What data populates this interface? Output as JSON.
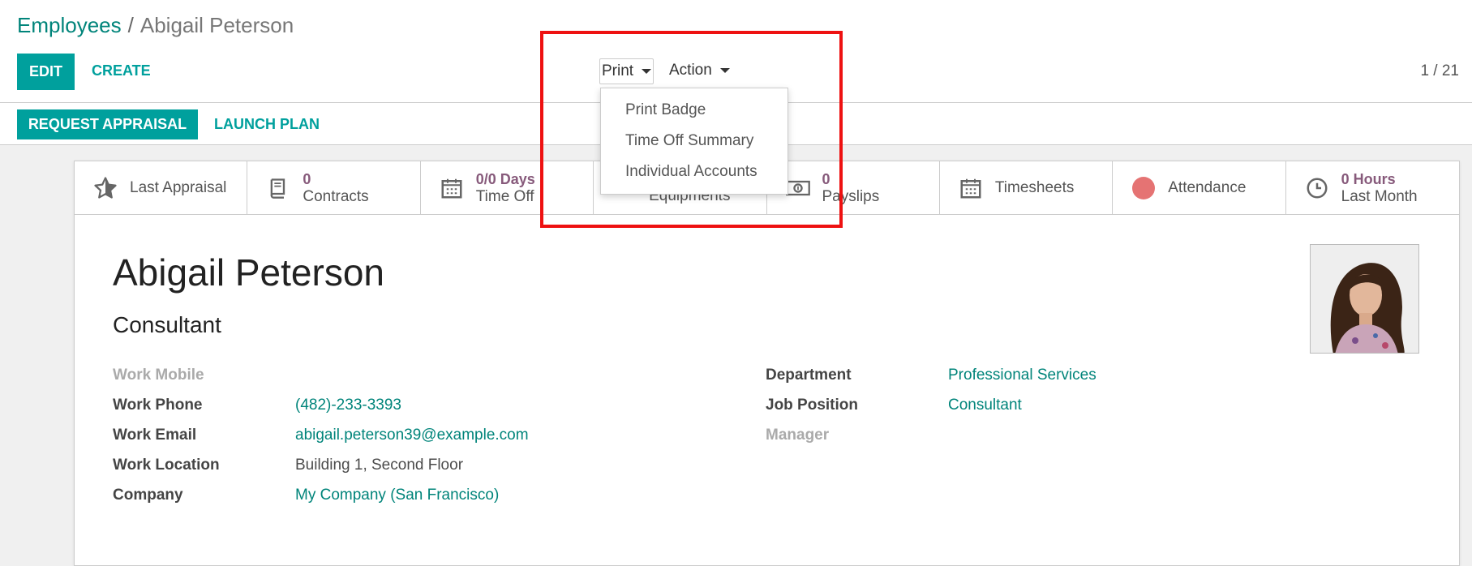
{
  "breadcrumb": {
    "parent": "Employees",
    "separator": "/",
    "current": "Abigail Peterson"
  },
  "toolbar": {
    "edit_label": "EDIT",
    "create_label": "CREATE",
    "print_label": "Print",
    "action_label": "Action",
    "pager": "1 / 21"
  },
  "print_menu": {
    "items": [
      "Print Badge",
      "Time Off Summary",
      "Individual Accounts"
    ]
  },
  "statusbar": {
    "request_appraisal": "REQUEST APPRAISAL",
    "launch_plan": "LAUNCH PLAN"
  },
  "smart_buttons": [
    {
      "icon": "star-icon",
      "label": "Last Appraisal"
    },
    {
      "icon": "book-icon",
      "value": "0",
      "label": "Contracts"
    },
    {
      "icon": "calendar-icon",
      "value": "0/0 Days",
      "label": "Time Off"
    },
    {
      "icon": "equipment-icon",
      "label": "Equipments"
    },
    {
      "icon": "money-icon",
      "value": "0",
      "label": "Payslips"
    },
    {
      "icon": "calendar-icon",
      "label": "Timesheets"
    },
    {
      "icon": "status-dot-icon",
      "label": "Attendance"
    },
    {
      "icon": "clock-icon",
      "value": "0 Hours",
      "label": "Last Month"
    }
  ],
  "employee": {
    "name": "Abigail Peterson",
    "job_title": "Consultant",
    "fields_left": [
      {
        "label": "Work Mobile",
        "value": ""
      },
      {
        "label": "Work Phone",
        "value": "(482)-233-3393"
      },
      {
        "label": "Work Email",
        "value": "abigail.peterson39@example.com"
      },
      {
        "label": "Work Location",
        "value": "Building 1, Second Floor"
      },
      {
        "label": "Company",
        "value": "My Company (San Francisco)"
      }
    ],
    "fields_right": [
      {
        "label": "Department",
        "value": "Professional Services"
      },
      {
        "label": "Job Position",
        "value": "Consultant"
      },
      {
        "label": "Manager",
        "value": ""
      }
    ]
  },
  "colors": {
    "primary": "#00a09d",
    "link": "#00847a",
    "accent_value": "#875a7b",
    "highlight": "#ee1111"
  }
}
